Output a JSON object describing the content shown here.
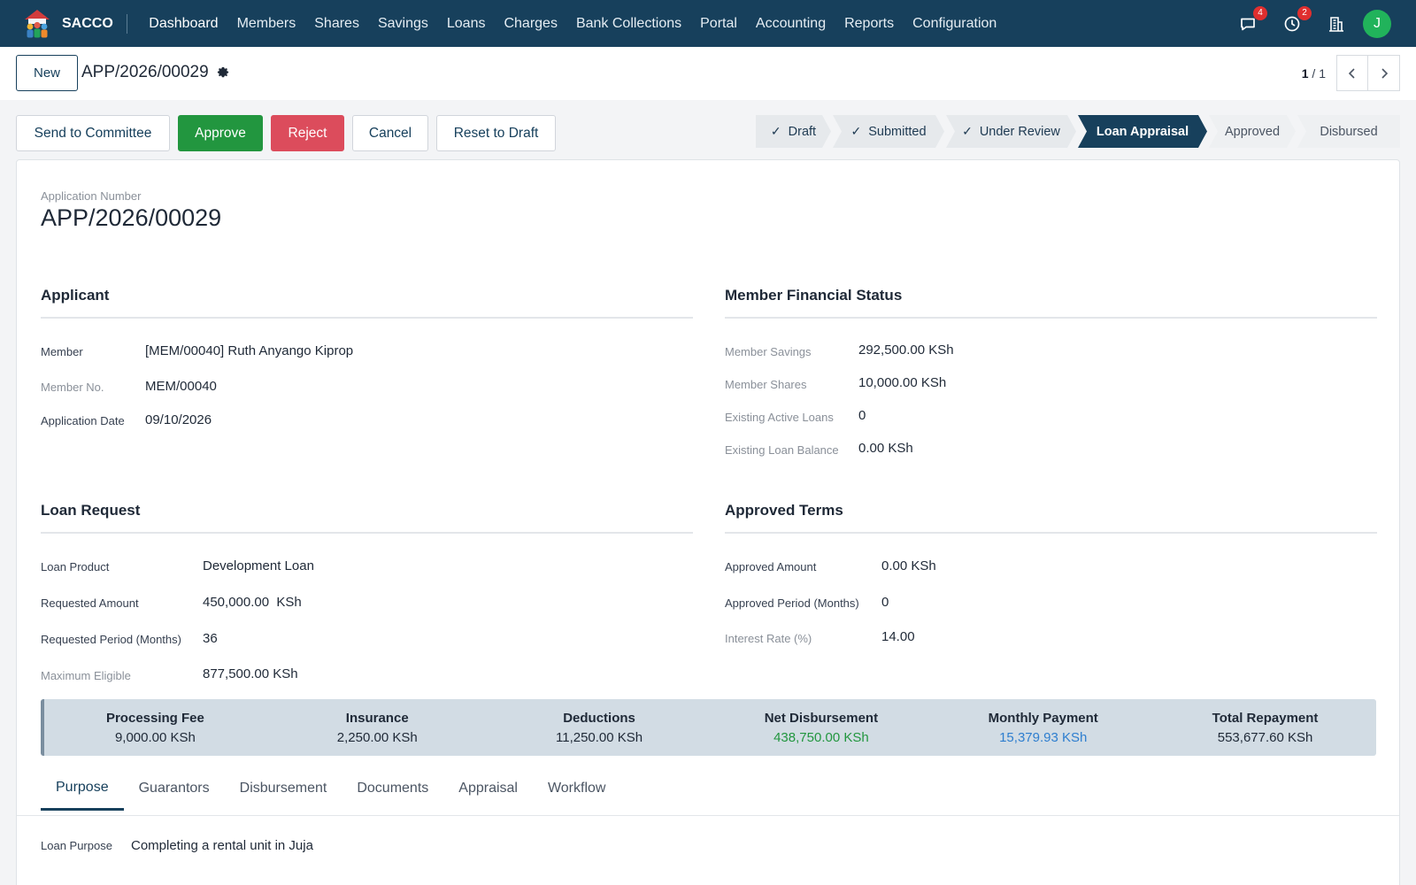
{
  "nav": {
    "brand": "SACCO",
    "menu": [
      "Dashboard",
      "Members",
      "Shares",
      "Savings",
      "Loans",
      "Charges",
      "Bank Collections",
      "Portal",
      "Accounting",
      "Reports",
      "Configuration"
    ],
    "messages_count": "4",
    "activities_count": "2",
    "avatar_initial": "J"
  },
  "control": {
    "new_label": "New",
    "record_title": "APP/2026/00029",
    "pager_current": "1",
    "pager_total": "/ 1"
  },
  "actions": {
    "send": "Send to Committee",
    "approve": "Approve",
    "reject": "Reject",
    "cancel": "Cancel",
    "reset": "Reset to Draft"
  },
  "status": {
    "stages": [
      "Draft",
      "Submitted",
      "Under Review",
      "Loan Appraisal",
      "Approved",
      "Disbursed"
    ],
    "check": "✓"
  },
  "form": {
    "app_number_label": "Application Number",
    "app_number": "APP/2026/00029",
    "applicant": {
      "title": "Applicant",
      "member_label": "Member",
      "member": "[MEM/00040] Ruth Anyango Kiprop",
      "member_no_label": "Member No.",
      "member_no": "MEM/00040",
      "date_label": "Application Date",
      "date": "09/10/2026"
    },
    "financial": {
      "title": "Member Financial Status",
      "savings_label": "Member Savings",
      "savings": "292,500.00 KSh",
      "shares_label": "Member Shares",
      "shares": "10,000.00 KSh",
      "active_loans_label": "Existing Active Loans",
      "active_loans": "0",
      "balance_label": "Existing Loan Balance",
      "balance": "0.00 KSh"
    },
    "request": {
      "title": "Loan Request",
      "product_label": "Loan Product",
      "product": "Development Loan",
      "amount_label": "Requested Amount",
      "amount": "450,000.00",
      "amount_currency": "KSh",
      "period_label": "Requested Period (Months)",
      "period": "36",
      "max_label": "Maximum Eligible",
      "max": "877,500.00 KSh"
    },
    "approved": {
      "title": "Approved Terms",
      "amount_label": "Approved Amount",
      "amount": "0.00 KSh",
      "period_label": "Approved Period (Months)",
      "period": "0",
      "rate_label": "Interest Rate (%)",
      "rate": "14.00"
    },
    "summary": [
      {
        "label": "Processing Fee",
        "value": "9,000.00 KSh"
      },
      {
        "label": "Insurance",
        "value": "2,250.00 KSh"
      },
      {
        "label": "Deductions",
        "value": "11,250.00 KSh"
      },
      {
        "label": "Net Disbursement",
        "value": "438,750.00 KSh"
      },
      {
        "label": "Monthly Payment",
        "value": "15,379.93 KSh"
      },
      {
        "label": "Total Repayment",
        "value": "553,677.60 KSh"
      }
    ],
    "summary_colors": {
      "net": "#22963f",
      "monthly": "#2e7ecf"
    },
    "tabs": [
      "Purpose",
      "Guarantors",
      "Disbursement",
      "Documents",
      "Appraisal",
      "Workflow"
    ],
    "purpose_label": "Loan Purpose",
    "purpose": "Completing a rental unit in Juja"
  }
}
